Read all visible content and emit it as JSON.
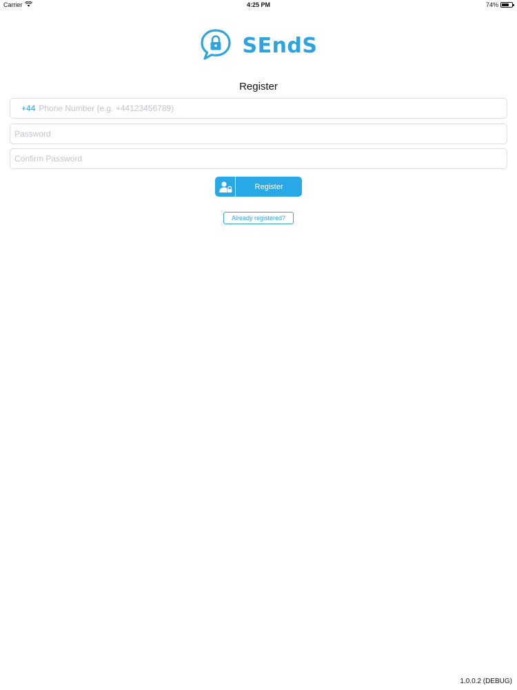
{
  "status_bar": {
    "carrier": "Carrier",
    "time": "4:25 PM",
    "battery_text": "74%",
    "battery_level": 0.74
  },
  "logo": {
    "text": "SEndS",
    "color": "#2ea3dd"
  },
  "form": {
    "title": "Register",
    "phone": {
      "country_code": "+44",
      "placeholder": "Phone Number (e.g. +44123456789)"
    },
    "password": {
      "placeholder": "Password"
    },
    "confirm_password": {
      "placeholder": "Confirm Password"
    },
    "register_button": {
      "label": "Register",
      "icon": "user-lock-icon",
      "color": "#28a8e6"
    },
    "already_registered": {
      "label": "Already registered?"
    }
  },
  "footer": {
    "version": "1.0.0.2 (DEBUG)"
  }
}
